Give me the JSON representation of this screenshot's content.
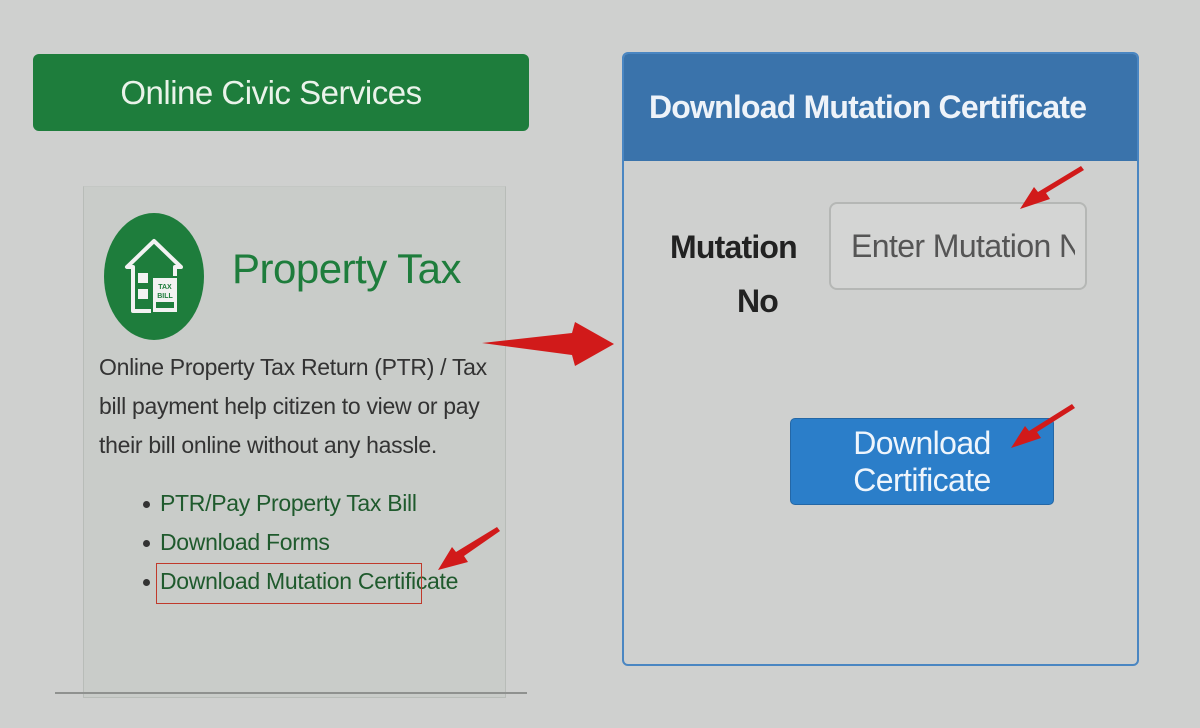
{
  "left": {
    "header": "Online Civic Services",
    "card": {
      "title": "Property Tax",
      "icon_text": "TAX BILL",
      "description": "Online Property Tax Return (PTR) / Tax bill payment help citizen to view or pay their bill online without any hassle.",
      "links": [
        "PTR/Pay Property Tax Bill",
        "Download Forms",
        "Download Mutation Certificate"
      ]
    }
  },
  "panel": {
    "title": "Download Mutation Certificate",
    "field_label_line1": "Mutation",
    "field_label_line2": "No",
    "input_placeholder": "Enter Mutation No..",
    "button_label": "Download Certificate"
  },
  "colors": {
    "green": "#1e7d3c",
    "panel_blue": "#3a73ab",
    "button_blue": "#2b7ec9",
    "annotation_red": "#d11a1a"
  }
}
